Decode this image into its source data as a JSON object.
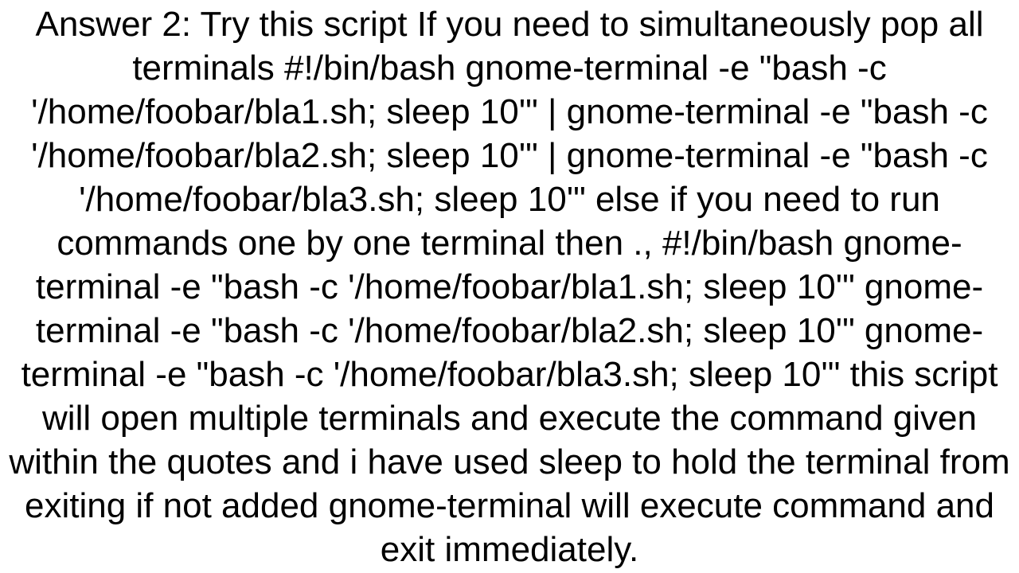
{
  "answer": {
    "text": "Answer 2: Try this script  If you need to simultaneously pop all terminals #!/bin/bash gnome-terminal -e \"bash -c '/home/foobar/bla1.sh; sleep 10'\" | gnome-terminal -e \"bash -c '/home/foobar/bla2.sh; sleep 10'\" | gnome-terminal -e \"bash -c '/home/foobar/bla3.sh; sleep 10'\"  else if you need to run commands one by one terminal then ., #!/bin/bash gnome-terminal -e \"bash -c '/home/foobar/bla1.sh; sleep 10'\" gnome-terminal -e \"bash -c '/home/foobar/bla2.sh; sleep 10'\" gnome-terminal -e \"bash -c '/home/foobar/bla3.sh; sleep 10'\"  this script will open multiple terminals and execute the command given within the quotes and i have used sleep to hold the terminal from exiting if not added gnome-terminal will execute command and exit immediately."
  }
}
